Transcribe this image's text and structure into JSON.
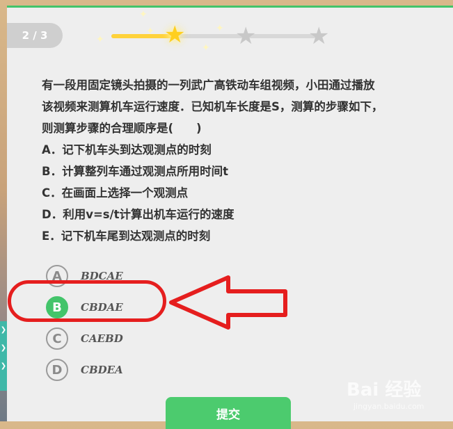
{
  "progress": {
    "label": "2 / 3"
  },
  "question": {
    "lines": [
      "有一段用固定镜头拍摄的一列武广高铁动车组视频，小田通过播放",
      "该视频来测算机车运行速度．已知机车长度是S，测算的步骤如下，",
      "则测算步骤的合理顺序是(　　)",
      "A．记下机车头到达观测点的时刻",
      "B．计算整列车通过观测点所用时间t",
      "C．在画面上选择一个观测点",
      "D．利用v=s/t计算出机车运行的速度",
      "E．记下机车尾到达观测点的时刻"
    ]
  },
  "options": [
    {
      "letter": "A",
      "text": "BDCAE",
      "selected": false
    },
    {
      "letter": "B",
      "text": "CBDAE",
      "selected": true
    },
    {
      "letter": "C",
      "text": "CAEBD",
      "selected": false
    },
    {
      "letter": "D",
      "text": "CBDEA",
      "selected": false
    }
  ],
  "submit": {
    "label": "提交"
  },
  "stars": [
    "star-icon",
    "star-icon",
    "star-icon"
  ],
  "colors": {
    "accent": "#43c46a",
    "annotation": "#e51e1e",
    "star_active": "#ffcf1f"
  },
  "watermark": {
    "brand": "Bai 经验",
    "url": "jingyan.baidu.com"
  }
}
